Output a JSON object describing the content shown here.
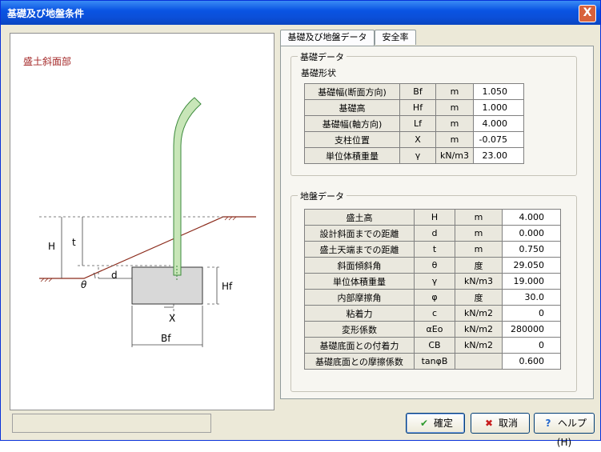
{
  "window": {
    "title": "基礎及び地盤条件",
    "close_label": "X"
  },
  "diagram": {
    "label": "盛土斜面部",
    "dim_labels": {
      "H": "H",
      "t": "t",
      "d": "d",
      "theta": "θ",
      "Hf": "Hf",
      "X": "X",
      "Bf": "Bf"
    }
  },
  "tabs": [
    {
      "label": "基礎及び地盤データ",
      "active": true
    },
    {
      "label": "安全率",
      "active": false
    }
  ],
  "foundation": {
    "group_title": "基礎データ",
    "subtitle": "基礎形状",
    "rows": [
      {
        "name": "基礎幅(断面方向)",
        "sym": "Bf",
        "unit": "m",
        "value": "1.050"
      },
      {
        "name": "基礎高",
        "sym": "Hf",
        "unit": "m",
        "value": "1.000"
      },
      {
        "name": "基礎幅(軸方向)",
        "sym": "Lf",
        "unit": "m",
        "value": "4.000"
      },
      {
        "name": "支柱位置",
        "sym": "X",
        "unit": "m",
        "value": "-0.075"
      },
      {
        "name": "単位体積重量",
        "sym": "γ",
        "unit": "kN/m3",
        "value": "23.00"
      }
    ]
  },
  "ground": {
    "group_title": "地盤データ",
    "rows": [
      {
        "name": "盛土高",
        "sym": "H",
        "unit": "m",
        "value": "4.000"
      },
      {
        "name": "設計斜面までの距離",
        "sym": "d",
        "unit": "m",
        "value": "0.000"
      },
      {
        "name": "盛土天端までの距離",
        "sym": "t",
        "unit": "m",
        "value": "0.750"
      },
      {
        "name": "斜面傾斜角",
        "sym": "θ",
        "unit": "度",
        "value": "29.050"
      },
      {
        "name": "単位体積重量",
        "sym": "γ",
        "unit": "kN/m3",
        "value": "19.000"
      },
      {
        "name": "内部摩擦角",
        "sym": "φ",
        "unit": "度",
        "value": "30.0"
      },
      {
        "name": "粘着力",
        "sym": "c",
        "unit": "kN/m2",
        "value": "0"
      },
      {
        "name": "変形係数",
        "sym": "αEo",
        "unit": "kN/m2",
        "value": "280000"
      },
      {
        "name": "基礎底面との付着力",
        "sym": "CB",
        "unit": "kN/m2",
        "value": "0"
      },
      {
        "name": "基礎底面との摩擦係数",
        "sym": "tanφB",
        "unit": "",
        "value": "0.600"
      }
    ]
  },
  "buttons": {
    "ok": {
      "label": "確定",
      "icon": "check-icon"
    },
    "cancel": {
      "label": "取消",
      "icon": "x-icon"
    },
    "help": {
      "label": "ヘルプ(H)",
      "icon": "question-icon"
    }
  },
  "status_text": ""
}
